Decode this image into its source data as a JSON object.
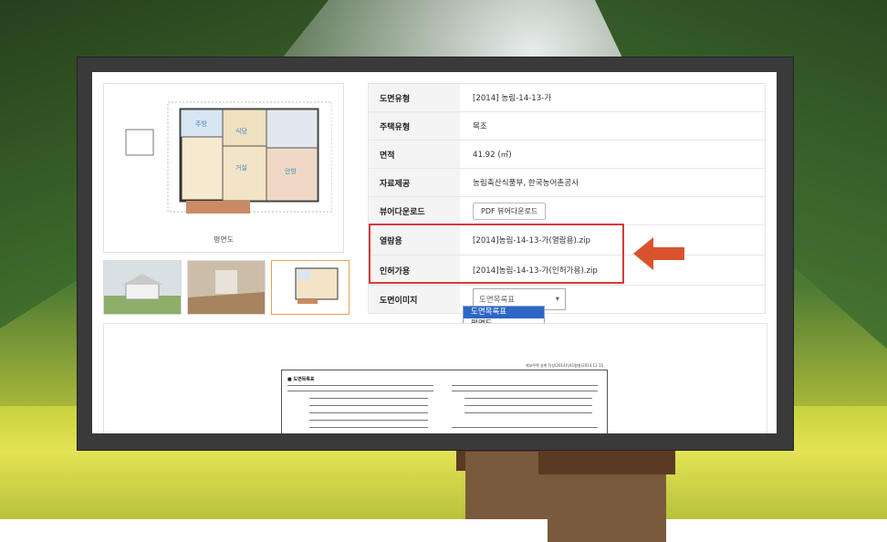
{
  "table": {
    "rows": [
      {
        "label": "도면유형",
        "value": "[2014] 농림-14-13-가"
      },
      {
        "label": "주택유형",
        "value": "목조"
      },
      {
        "label": "면적",
        "value": "41.92 (㎡)"
      },
      {
        "label": "자료제공",
        "value": "농림축산식품부, 한국농어촌공사"
      },
      {
        "label": "뷰어다운로드",
        "button": "PDF 뷰어다운로드"
      },
      {
        "label": "열람용",
        "value": "[2014]농림-14-13-가(열람용).zip"
      },
      {
        "label": "인허가용",
        "value": "[2014]농림-14-13-가(인허가용).zip"
      },
      {
        "label": "도면이미지",
        "select_value": "도면목록표"
      }
    ]
  },
  "dropdown": {
    "options": [
      "도면목록표",
      "평면도"
    ],
    "selected": "도면목록표"
  },
  "image_panel": {
    "caption": "평면도"
  },
  "floorplan_labels": [
    "주방",
    "식당",
    "거실",
    "안방"
  ],
  "document": {
    "title": "■ 도면목록표",
    "header": "에코주택 설계 작성(2014)\\(41평형)2014.12.15"
  },
  "colors": {
    "highlight": "#d33b3b",
    "arrow": "#d9542e",
    "selected_option": "#2d66c7"
  }
}
